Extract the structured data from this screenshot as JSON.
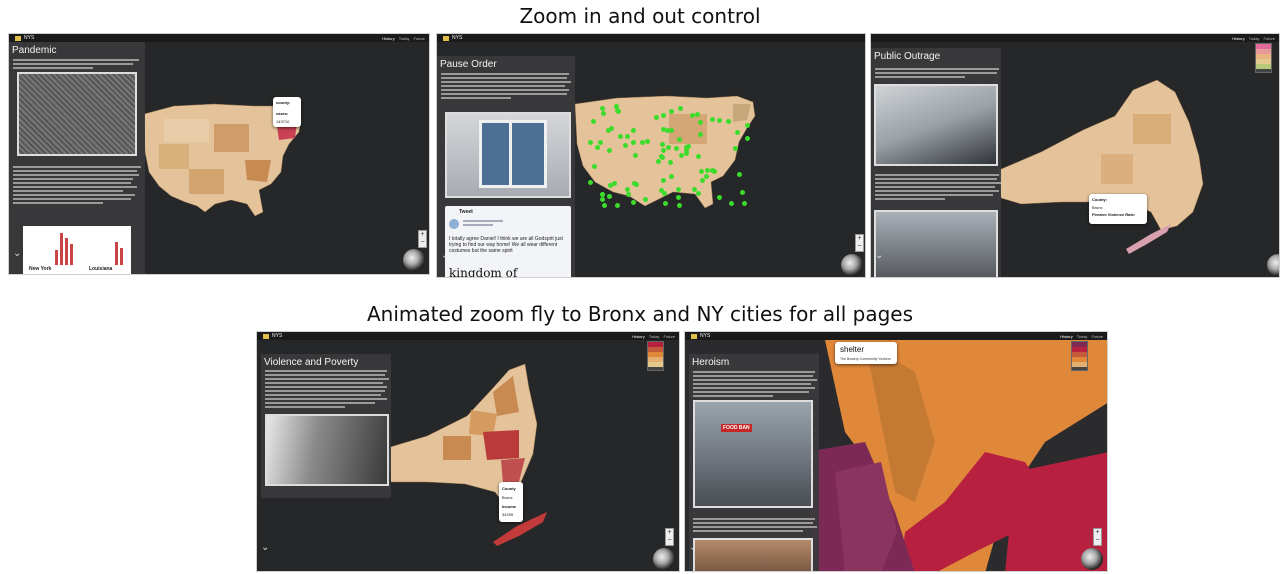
{
  "captions": {
    "top": "Zoom in and out control",
    "bottom": "Animated zoom fly to Bronx and NY cities for all pages"
  },
  "app": {
    "brand": "NYS",
    "tabs": [
      "History",
      "Today",
      "Future"
    ]
  },
  "panels": [
    {
      "story_title": "Pandemic",
      "photo_labels": [
        "New York",
        "Louisiana"
      ],
      "popup": {
        "county_label": "county:",
        "cases_label": "cases:",
        "value": "143710"
      }
    },
    {
      "story_title": "Pause Order",
      "tweet_header": "Tweet",
      "tweet_text": "I totally agree Daniel! I think we are all Godsprit just trying to find our way home! We all wear different costumes but the same spirit",
      "tweet_image_text": "kingdom of"
    },
    {
      "story_title": "Public Outrage",
      "popup": {
        "county_label": "County:",
        "county_value": "Bronx",
        "rate_label": "Firearm Violence Rate:"
      }
    },
    {
      "story_title": "Violence and Poverty",
      "popup": {
        "county_label": "County",
        "county_value": "Bronx",
        "income_label": "Income",
        "income_value": "34299"
      }
    },
    {
      "story_title": "Heroism",
      "photo_sign": "FOOD BAN",
      "popup": {
        "title": "shelter",
        "subtitle": "The Bowery Community Yonkers"
      }
    }
  ],
  "colors": {
    "background": "#262728",
    "legend": [
      "#e36b99",
      "#e89a9a",
      "#e8b37e",
      "#e4c98f",
      "#b8c97a"
    ],
    "choropleth_light": "#e4c39a",
    "choropleth_mid": "#c98a52",
    "choropleth_dark": "#b93a3a",
    "heroism_orange": "#e0883a",
    "heroism_crimson": "#b8203f",
    "heroism_plum": "#7c2a55",
    "tweet_dots": "#3cdc2c"
  }
}
